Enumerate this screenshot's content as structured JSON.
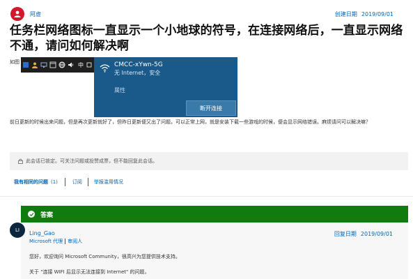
{
  "question": {
    "author": "阿虚",
    "created_label": "创建日期",
    "created_date": "2019/09/01",
    "title": "任务栏网络图标一直显示一个小地球的符号，在连接网络后，一直显示网络不通，请问如何解决啊",
    "prefix": "如图",
    "body": "前日更新的时候出来问题，但是再次更新就好了，但昨日更新便又出了问题，可以正常上网，就是安装下载一些游戏的时候，便会显示网络错误。麻烦请问可以解决嘛？"
  },
  "screenshot": {
    "ime": "中",
    "ssid": "CMCC-xYwn-5G",
    "status": "无 Internet，安全",
    "properties": "属性",
    "disconnect": "断开连接"
  },
  "locked": {
    "text": "此会话已锁定。可关注问题或投赞成票，但不能回复此会话。"
  },
  "actions": {
    "same_question": "我有相同的问题",
    "count": "(1)",
    "subscribe": "订阅",
    "report": "举报滥用情况"
  },
  "answer": {
    "label": "答案",
    "avatar_initials": "LI",
    "name": "Ling_Gao",
    "role1": "Microsoft 代理",
    "role2": "审阅人",
    "replied_label": "回复日期",
    "replied_date": "2019/09/01",
    "greeting": "您好，欢迎询问 Microsoft Community，很高兴为您提供技术支持。",
    "about": "关于 \"连接 WIFI 后显示无法连接到 Internet\" 的问题，"
  },
  "colors": {
    "accent": "#0067b8",
    "answer_green": "#107c10",
    "avatar_red": "#d3172c",
    "flyout_blue": "#1a5a8a"
  }
}
